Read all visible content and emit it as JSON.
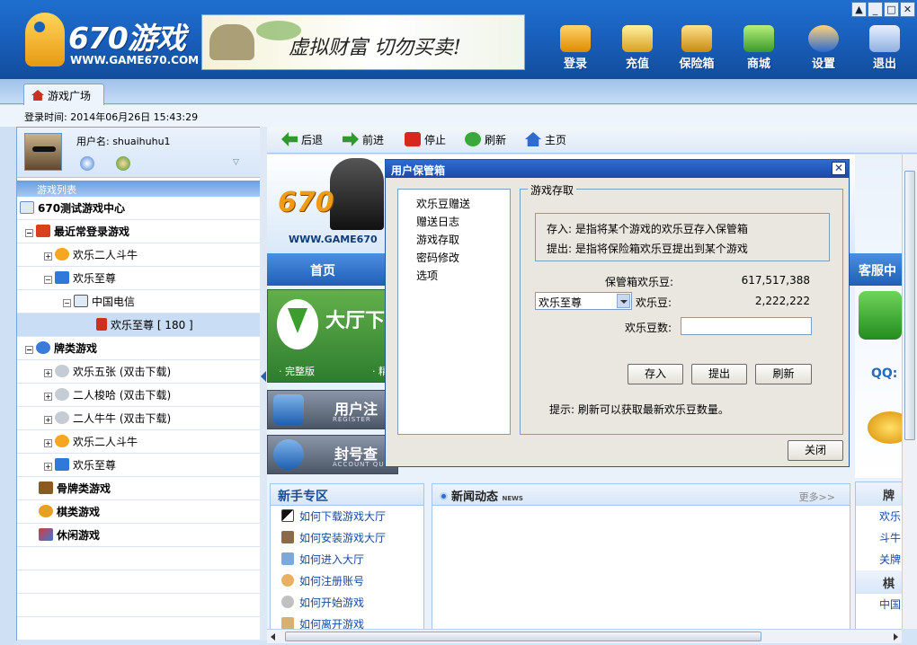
{
  "header": {
    "logo_name": "670游戏",
    "logo_url": "WWW.GAME670.COM",
    "banner_slogan": "虚拟财富 切勿买卖!",
    "buttons": [
      {
        "label": "登录",
        "icon": "login-icon"
      },
      {
        "label": "充值",
        "icon": "recharge-icon"
      },
      {
        "label": "保险箱",
        "icon": "safebox-icon"
      },
      {
        "label": "商城",
        "icon": "shop-icon"
      },
      {
        "label": "设置",
        "icon": "settings-icon"
      },
      {
        "label": "退出",
        "icon": "exit-icon"
      }
    ]
  },
  "tabs": [
    {
      "label": "游戏广场",
      "icon": "home-icon"
    }
  ],
  "login_time": "登录时间: 2014年06月26日 15:43:29",
  "user": {
    "label": "用户名: shuaihuhu1"
  },
  "tree": {
    "header": "游戏列表",
    "rows": [
      {
        "label": "670测试游戏中心"
      },
      {
        "label": "最近常登录游戏"
      },
      {
        "label": "欢乐二人斗牛"
      },
      {
        "label": "欢乐至尊"
      },
      {
        "label": "中国电信"
      },
      {
        "label": "欢乐至尊 [ 180 ]"
      },
      {
        "label": "牌类游戏"
      },
      {
        "label": "欢乐五张 (双击下载)"
      },
      {
        "label": "二人梭哈 (双击下载)"
      },
      {
        "label": "二人牛牛 (双击下载)"
      },
      {
        "label": "欢乐二人斗牛"
      },
      {
        "label": "欢乐至尊"
      },
      {
        "label": "骨牌类游戏"
      },
      {
        "label": "棋类游戏"
      },
      {
        "label": "休闲游戏"
      }
    ]
  },
  "nav": {
    "back": "后退",
    "forward": "前进",
    "stop": "停止",
    "refresh": "刷新",
    "home": "主页"
  },
  "content": {
    "hero_logo": "670",
    "hero_url": "WWW.GAME670",
    "menu_first": "首页",
    "download_title": "大厅下",
    "download_full": "· 完整版",
    "download_lite": "· 精",
    "register_title": "用户注",
    "register_sub": "REGISTER",
    "ban_title": "封号查",
    "ban_sub": "ACCOUNT QU",
    "newbie_title": "新手专区",
    "newbie_links": [
      "如何下载游戏大厅",
      "如何安装游戏大厅",
      "如何进入大厅",
      "如何注册账号",
      "如何开始游戏",
      "如何离开游戏"
    ],
    "news_title": "新闻动态",
    "news_sub": "NEWS",
    "news_more": "更多>>",
    "service_label": "客服中",
    "qq_label": "QQ:",
    "right_list_header": "牌",
    "right_list": [
      "欢乐",
      "斗牛",
      "关牌"
    ],
    "right_list_header2": "棋",
    "right_list_last": "中国"
  },
  "dialog": {
    "title": "用户保管箱",
    "menu": [
      "欢乐豆赠送",
      "赠送日志",
      "游戏存取",
      "密码修改",
      "选项"
    ],
    "group_title": "游戏存取",
    "info_line1": "存入: 是指将某个游戏的欢乐豆存入保管箱",
    "info_line2": "提出: 是指将保险箱欢乐豆提出到某个游戏",
    "box_label": "保管箱欢乐豆:",
    "box_value": "617,517,388",
    "game_select": "欢乐至尊",
    "game_label": "欢乐豆:",
    "game_value": "2,222,222",
    "amount_label": "欢乐豆数:",
    "amount_value": "",
    "btn_deposit": "存入",
    "btn_withdraw": "提出",
    "btn_refresh": "刷新",
    "tip": "提示: 刷新可以获取最新欢乐豆数量。",
    "btn_close": "关闭"
  },
  "colors": {
    "header_blue": "#1a60bd",
    "dialog_title": "#2f6bd0",
    "accent_orange": "#f29a12"
  }
}
